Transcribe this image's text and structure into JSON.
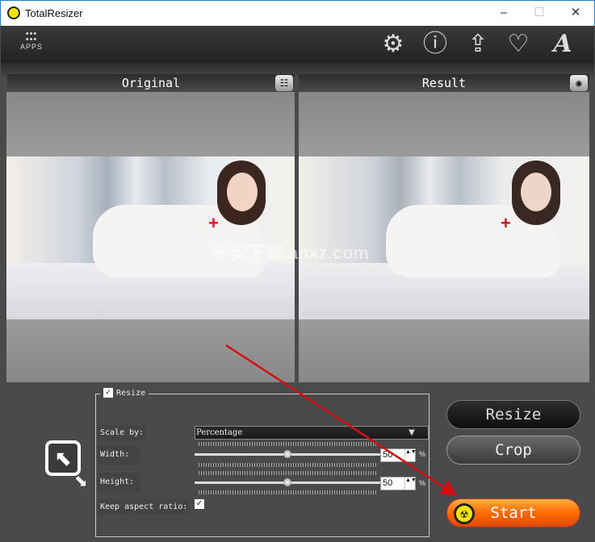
{
  "window": {
    "title": "TotalResizer",
    "minimize": "–",
    "maximize": "☐",
    "close": "✕"
  },
  "toolbar": {
    "apps_label": "APPS",
    "apps_dots": "•••\n•••",
    "icons": [
      "gear-icon",
      "info-icon",
      "share-icon",
      "heart-icon",
      "font-icon"
    ],
    "glyphs": {
      "gear": "⚙",
      "info": "ⓘ",
      "share": "⇪",
      "heart": "♡",
      "font": "A"
    }
  },
  "panels": {
    "original": {
      "title": "Original",
      "button_glyph": "☷"
    },
    "result": {
      "title": "Result",
      "button_glyph": "◉"
    }
  },
  "photo": {
    "cross": "+"
  },
  "watermark": {
    "text": "安下载 anxz.com"
  },
  "resize_group": {
    "title": "Resize",
    "enabled": true,
    "scale_by_label": "Scale by:",
    "scale_by_value": "Percentage",
    "dropdown_arrow": "▼",
    "width_label": "Width:",
    "width_value": "50",
    "width_percent": 50,
    "height_label": "Height:",
    "height_value": "50",
    "height_percent": 50,
    "unit": "%",
    "keep_aspect_label": "Keep aspect ratio:",
    "keep_aspect": true,
    "check": "✓",
    "spin": "▲▼"
  },
  "buttons": {
    "resize": "Resize",
    "crop": "Crop",
    "start": "Start"
  },
  "icons": {
    "resize_corner": "⬉",
    "resize_arrow": "⬊",
    "start_glyph": "☢"
  },
  "colors": {
    "accent_orange": "#ff6a00",
    "annotation_red": "#d01010",
    "background": "#4a494c"
  }
}
